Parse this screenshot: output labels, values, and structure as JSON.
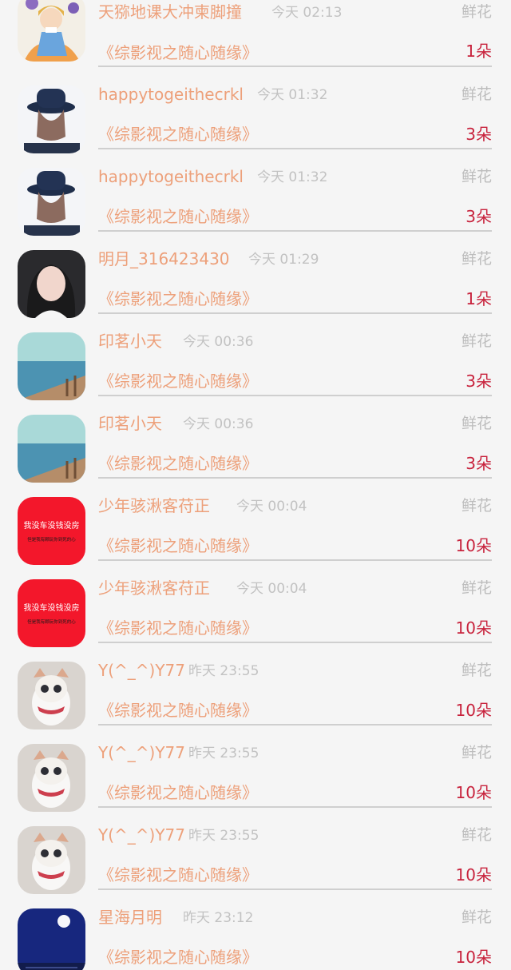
{
  "gift_label": "鲜花",
  "records": [
    {
      "name": "天猕地课大冲柬脚撞",
      "time": "今天 02:13",
      "work": "《综影视之随心随缘》",
      "count": "1朵",
      "avatar": "cartoon-girl"
    },
    {
      "name": "happytogeithecrkl",
      "time": "今天 01:32",
      "work": "《综影视之随心随缘》",
      "count": "3朵",
      "avatar": "hat-girl"
    },
    {
      "name": "happytogeithecrkl",
      "time": "今天 01:32",
      "work": "《综影视之随心随缘》",
      "count": "3朵",
      "avatar": "hat-girl"
    },
    {
      "name": "明月_316423430",
      "time": "今天 01:29",
      "work": "《综影视之随心随缘》",
      "count": "1朵",
      "avatar": "portrait-girl"
    },
    {
      "name": "印茗小天",
      "time": "今天 00:36",
      "work": "《综影视之随心随缘》",
      "count": "3朵",
      "avatar": "sea"
    },
    {
      "name": "印茗小天",
      "time": "今天 00:36",
      "work": "《综影视之随心随缘》",
      "count": "3朵",
      "avatar": "sea"
    },
    {
      "name": "少年骇湫客苻正",
      "time": "今天 00:04",
      "work": "《综影视之随心随缘》",
      "count": "10朵",
      "avatar": "red-text"
    },
    {
      "name": "少年骇湫客苻正",
      "time": "今天 00:04",
      "work": "《综影视之随心随缘》",
      "count": "10朵",
      "avatar": "red-text"
    },
    {
      "name": "Y(^_^)Y77",
      "time": "昨天 23:55",
      "work": "《综影视之随心随缘》",
      "count": "10朵",
      "avatar": "cat"
    },
    {
      "name": "Y(^_^)Y77",
      "time": "昨天 23:55",
      "work": "《综影视之随心随缘》",
      "count": "10朵",
      "avatar": "cat"
    },
    {
      "name": "Y(^_^)Y77",
      "time": "昨天 23:55",
      "work": "《综影视之随心随缘》",
      "count": "10朵",
      "avatar": "cat"
    },
    {
      "name": "星海月明",
      "time": "昨天 23:12",
      "work": "《综影视之随心随缘》",
      "count": "10朵",
      "avatar": "moon-night"
    }
  ],
  "avatar_text": {
    "red_line1": "我没车没钱没房",
    "red_line2": "但是我有颗玩你到死的心"
  },
  "colors": {
    "name": "#eda07a",
    "count": "#c8233d",
    "time": "#c2c2c2",
    "gift": "#bdbdbd"
  }
}
